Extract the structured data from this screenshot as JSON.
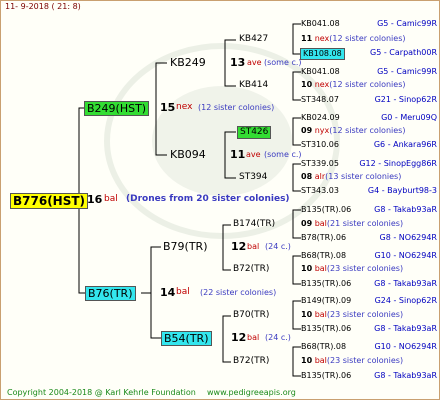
{
  "header": "11-  9-2018 ( 21:  8)",
  "footer": {
    "copyright": "Copyright 2004-2018 @ Karl Kehrle Foundation",
    "site": "www.pedigreeapis.org"
  },
  "root": {
    "name": "B776(HST)",
    "gen": "16",
    "ave": "bal",
    "note": "(Drones from 20 sister colonies)"
  },
  "father": {
    "name": "B249(HST)",
    "gen": "15",
    "ave": "nex",
    "note": "(12 sister colonies)"
  },
  "mother": {
    "name": "B76(TR)",
    "gen": "14",
    "ave": "bal",
    "note": "(22 sister colonies)"
  },
  "ff": {
    "name": "KB249",
    "gen": "13",
    "ave": "ave",
    "note": "(some c.)"
  },
  "fm": {
    "name": "KB094",
    "gen": "11",
    "ave": "ave",
    "note": "(some c.)"
  },
  "mf": {
    "name": "B79(TR)",
    "gen": "12",
    "ave": "bal",
    "note": "(24 c.)"
  },
  "mm": {
    "name": "B54(TR)",
    "gen": "12",
    "ave": "bal",
    "note": "(24 c.)"
  },
  "g3": [
    {
      "name": "KB427",
      "gen": "11",
      "ave": "nex",
      "note": "(12 sister colonies)",
      "top": "KB041.08",
      "top_info": "G5 - Camic99R",
      "bot": "KB108.08",
      "bot_info": "G5 - Carpath00R"
    },
    {
      "name": "KB414",
      "gen": "10",
      "ave": "nex",
      "note": "(12 sister colonies)",
      "top": "KB041.08",
      "top_info": "G5 - Camic99R",
      "bot": "ST348.07",
      "bot_info": "G21 - Sinop62R"
    },
    {
      "name": "ST426",
      "gen": "09",
      "ave": "nyx",
      "note": "(12 sister colonies)",
      "top": "KB024.09",
      "top_info": "G0 - Meru09Q",
      "bot": "ST310.06",
      "bot_info": "G6 - Ankara96R"
    },
    {
      "name": "ST394",
      "gen": "08",
      "ave": "alr",
      "note": "(13 sister colonies)",
      "top": "ST339.05",
      "top_info": "G12 - SinopEgg86R",
      "bot": "ST343.03",
      "bot_info": "G4 - Bayburt98-3"
    },
    {
      "name": "B174(TR)",
      "gen": "09",
      "ave": "bal",
      "note": "(21 sister colonies)",
      "top": "B135(TR).06",
      "top_info": "G8 - Takab93aR",
      "bot": "B78(TR).06",
      "bot_info": "G8 - NO6294R"
    },
    {
      "name": "B72(TR)",
      "gen": "10",
      "ave": "bal",
      "note": "(23 sister colonies)",
      "top": "B68(TR).08",
      "top_info": "G10 - NO6294R",
      "bot": "B135(TR).06",
      "bot_info": "G8 - Takab93aR"
    },
    {
      "name": "B70(TR)",
      "gen": "10",
      "ave": "bal",
      "note": "(23 sister colonies)",
      "top": "B149(TR).09",
      "top_info": "G24 - Sinop62R",
      "bot": "B135(TR).06",
      "bot_info": "G8 - Takab93aR"
    },
    {
      "name": "B72(TR)",
      "gen": "10",
      "ave": "bal",
      "note": "(23 sister colonies)",
      "top": "B68(TR).08",
      "top_info": "G10 - NO6294R",
      "bot": "B135(TR).06",
      "bot_info": "G8 - Takab93aR"
    }
  ]
}
